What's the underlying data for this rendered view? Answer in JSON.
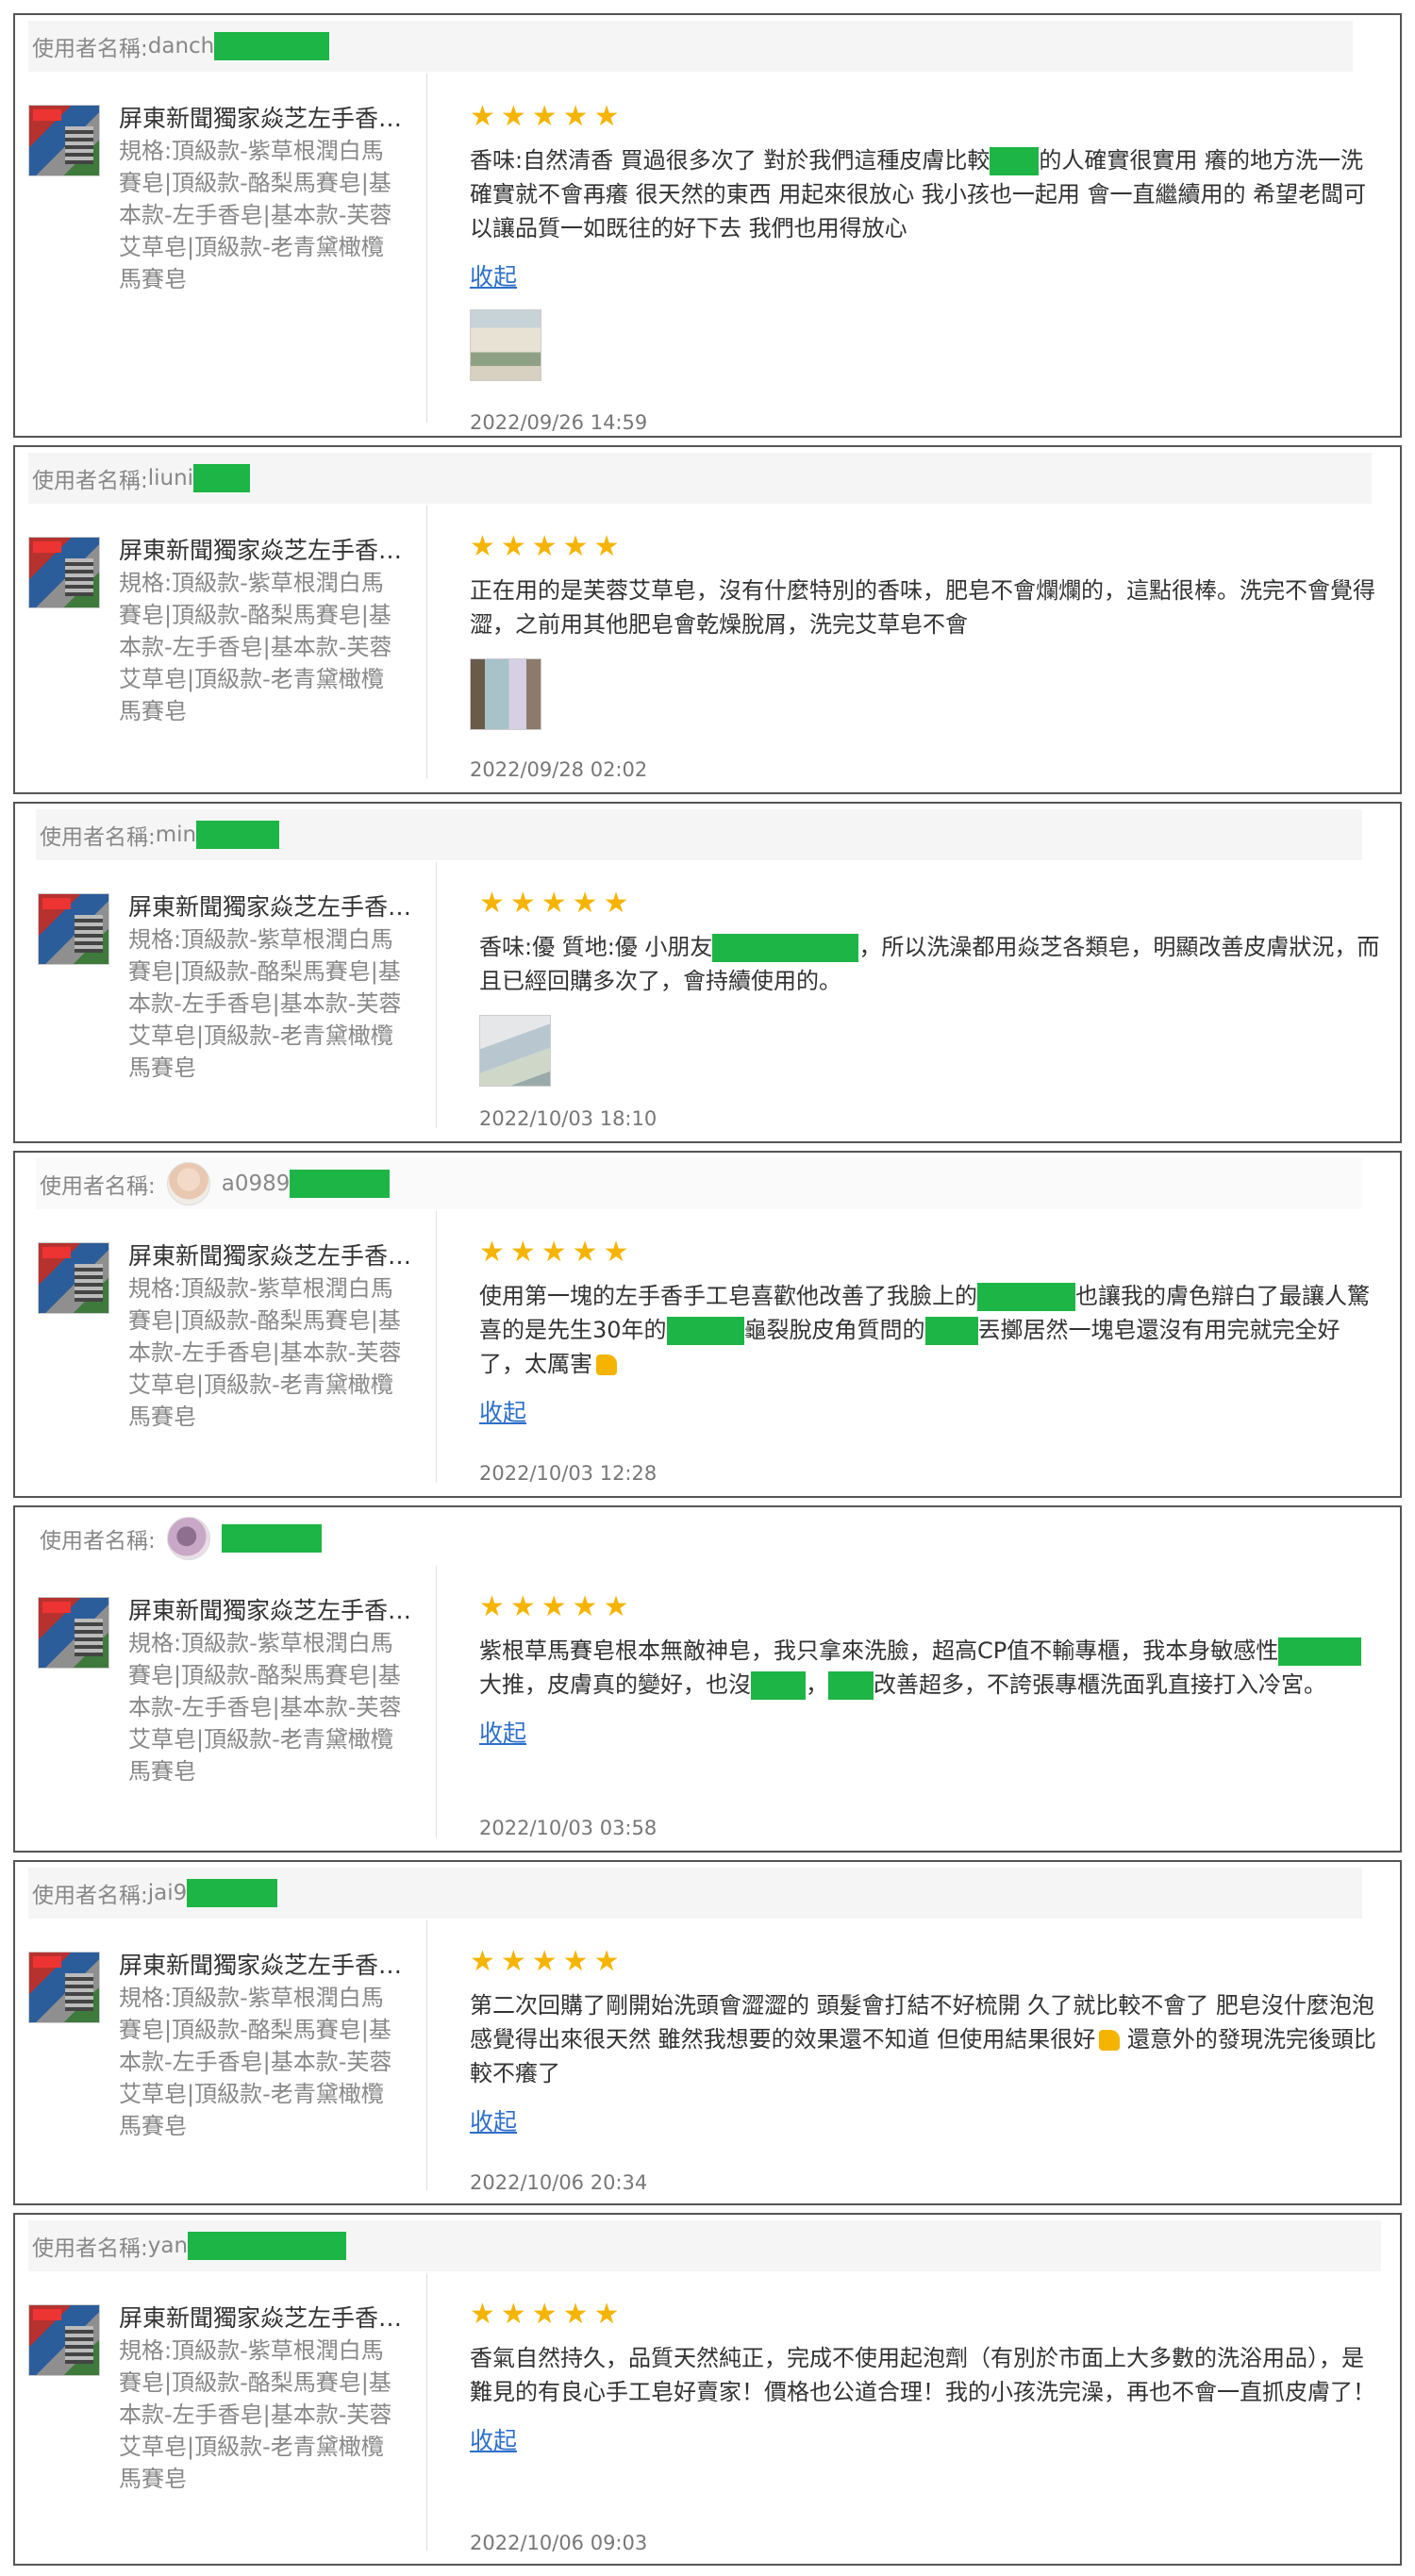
{
  "ui": {
    "user_label": "使用者名稱:",
    "collapse_label": "收起",
    "stars": "★★★★★"
  },
  "product": {
    "title": "屏東新聞獨家焱芝左手香手工皂",
    "spec": "規格:頂級款-紫草根潤白馬賽皂|頂級款-酪梨馬賽皂|基本款-左手香皂|基本款-芙蓉艾草皂|頂級款-老青黛橄欖馬賽皂"
  },
  "reviews": [
    {
      "username": "danch",
      "parts": [
        "香味:自然清香 買過很多次了 對於我們這種皮膚比較",
        "",
        "的人確實很實用 癢的地方洗一洗確實就不會再癢 很天然的東西 用起來很放心 我小孩也一起用 會一直繼續用的 希望老闆可以讓品質一如既往的好下去 我們也用得放心"
      ],
      "date": "2022/09/26 14:59"
    },
    {
      "username": "liuni",
      "parts": [
        "正在用的是芙蓉艾草皂，沒有什麼特別的香味，肥皂不會爛爛的，這點很棒。洗完不會覺得澀，之前用其他肥皂會乾燥脫屑，洗完艾草皂不會"
      ],
      "date": "2022/09/28 02:02"
    },
    {
      "username": "min",
      "parts": [
        "香味:優 質地:優 小朋友",
        "",
        "，所以洗澡都用焱芝各類皂，明顯改善皮膚狀況，而且已經回購多次了，會持續使用的。"
      ],
      "date": "2022/10/03 18:10"
    },
    {
      "username": "a0989",
      "parts": [
        "使用第一塊的左手香手工皂喜歡他改善了我臉上的",
        "",
        "也讓我的膚色辯白了最讓人驚喜的是先生30年的",
        "",
        "龜裂脫皮角質問的",
        "",
        "丟擲居然一塊皂還沒有用完就完全好了，太厲害"
      ],
      "date": "2022/10/03 12:28"
    },
    {
      "username": "",
      "parts": [
        "紫根草馬賽皂根本無敵神皂，我只拿來洗臉，超高CP值不輸專櫃，我本身敏感性",
        "",
        "大推，皮膚真的變好，也沒",
        "",
        "，",
        "",
        "改善超多，不誇張專櫃洗面乳直接打入冷宮。"
      ],
      "date": "2022/10/03 03:58"
    },
    {
      "username": "jai9",
      "parts": [
        "第二次回購了剛開始洗頭會澀澀的 頭髮會打結不好梳開 久了就比較不會了 肥皂沒什麼泡泡感覺得出來很天然 雖然我想要的效果還不知道 但使用結果很好",
        "還意外的發現洗完後頭比較不癢了"
      ],
      "date": "2022/10/06 20:34"
    },
    {
      "username": "yan",
      "parts": [
        "香氣自然持久，品質天然純正，完成不使用起泡劑（有別於市面上大多數的洗浴用品），是難見的有良心手工皂好賣家！價格也公道合理！我的小孩洗完澡，再也不會一直抓皮膚了！"
      ],
      "date": "2022/10/06 09:03"
    }
  ]
}
